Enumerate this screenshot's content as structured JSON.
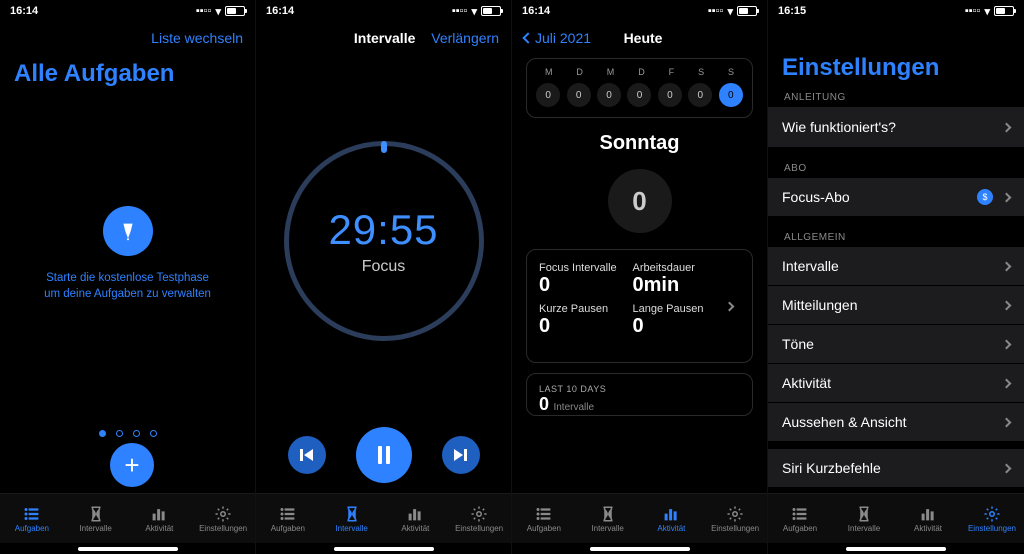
{
  "status": {
    "time1": "16:14",
    "time2": "16:14",
    "time3": "16:14",
    "time4": "16:15"
  },
  "tabs": {
    "aufgaben": "Aufgaben",
    "intervalle": "Intervalle",
    "aktivitat": "Aktivität",
    "einstellungen": "Einstellungen"
  },
  "screen1": {
    "nav_link": "Liste wechseln",
    "title": "Alle Aufgaben",
    "trial_line1": "Starte die kostenlose Testphase",
    "trial_line2": "um deine Aufgaben zu verwalten",
    "add": "+"
  },
  "screen2": {
    "nav_title": "Intervalle",
    "nav_link": "Verlängern",
    "time": "29:55",
    "label": "Focus"
  },
  "screen3": {
    "nav_back": "Juli 2021",
    "nav_title": "Heute",
    "weekdays": [
      "M",
      "D",
      "M",
      "D",
      "F",
      "S",
      "S"
    ],
    "counts": [
      "0",
      "0",
      "0",
      "0",
      "0",
      "0",
      "0"
    ],
    "dayname": "Sonntag",
    "bigcount": "0",
    "s1l": "Focus Intervalle",
    "s1v": "0",
    "s2l": "Arbeitsdauer",
    "s2v": "0min",
    "s3l": "Kurze Pausen",
    "s3v": "0",
    "s4l": "Lange Pausen",
    "s4v": "0",
    "last_label": "LAST 10 DAYS",
    "last_val": "0",
    "last_unit": "Intervalle"
  },
  "screen4": {
    "title": "Einstellungen",
    "sec1": "ANLEITUNG",
    "r1": "Wie funktioniert's?",
    "sec2": "ABO",
    "r2": "Focus-Abo",
    "badge": "$",
    "sec3": "ALLGEMEIN",
    "r3": "Intervalle",
    "r4": "Mitteilungen",
    "r5": "Töne",
    "r6": "Aktivität",
    "r7": "Aussehen & Ansicht",
    "r8": "Siri Kurzbefehle"
  }
}
